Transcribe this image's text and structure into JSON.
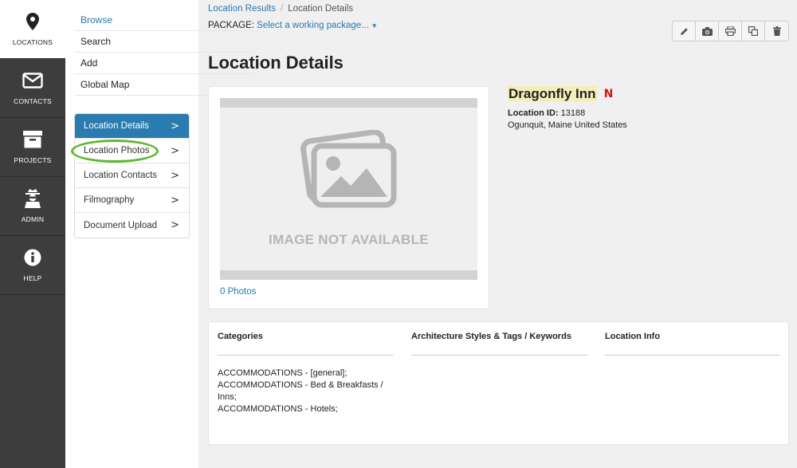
{
  "rail": {
    "items": [
      {
        "label": "LOCATIONS",
        "icon": "map-pin-icon"
      },
      {
        "label": "CONTACTS",
        "icon": "envelope-icon"
      },
      {
        "label": "PROJECTS",
        "icon": "archive-box-icon"
      },
      {
        "label": "ADMIN",
        "icon": "user-secret-icon"
      },
      {
        "label": "HELP",
        "icon": "info-circle-icon"
      }
    ]
  },
  "subnav": {
    "links": [
      "Browse",
      "Search",
      "Add",
      "Global Map"
    ]
  },
  "detail_nav": {
    "items": [
      "Location Details",
      "Location Photos",
      "Location Contacts",
      "Filmography",
      "Document Upload"
    ],
    "chevron": ">"
  },
  "breadcrumb": {
    "parent": "Location Results",
    "separator": "/",
    "current": "Location Details"
  },
  "package": {
    "label": "PACKAGE:",
    "link": "Select a working package...",
    "caret": "▼"
  },
  "toolbar": {
    "icons": [
      "pencil-icon",
      "camera-icon",
      "print-icon",
      "copy-icon",
      "trash-icon"
    ]
  },
  "page_title": "Location Details",
  "photo": {
    "placeholder_text": "IMAGE NOT AVAILABLE",
    "photos_link": "0 Photos"
  },
  "location": {
    "name": "Dragonfly Inn",
    "flag": "N",
    "id_label": "Location ID:",
    "id_value": "13188",
    "address": "Ogunquit, Maine United States"
  },
  "info": {
    "categories_title": "Categories",
    "categories": [
      "ACCOMMODATIONS - [general];",
      "ACCOMMODATIONS - Bed & Breakfasts /",
      "Inns;",
      "ACCOMMODATIONS - Hotels;"
    ],
    "arch_title": "Architecture Styles & Tags / Keywords",
    "loc_info_title": "Location Info"
  },
  "colors": {
    "accent": "#2a7bb0",
    "rail": "#3d3d3d",
    "highlight": "#5fb830",
    "name_highlight": "#f6eeb9"
  }
}
